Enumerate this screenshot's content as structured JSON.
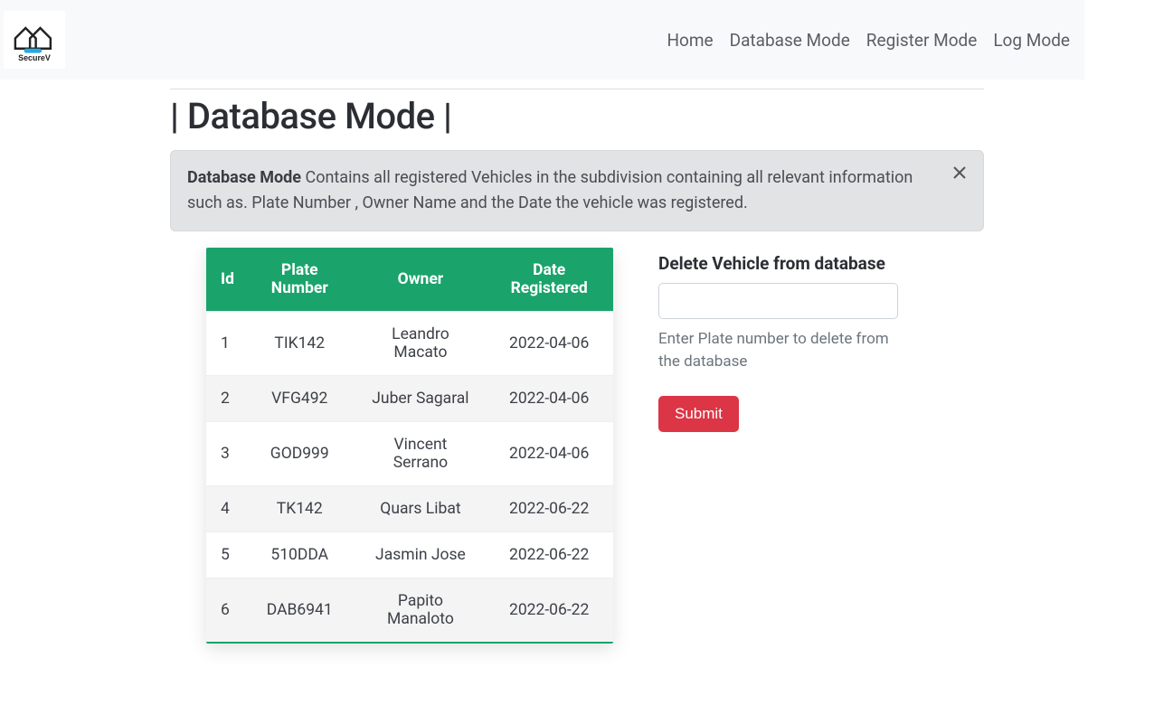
{
  "brand": "SecureV",
  "nav": {
    "home": "Home",
    "database": "Database Mode",
    "register": "Register Mode",
    "log": "Log Mode"
  },
  "title": "| Database Mode |",
  "alert": {
    "strong": "Database Mode",
    "body": " Contains all registered Vehicles in the subdivision containing all relevant information such as. Plate Number , Owner Name and the Date the vehicle was registered."
  },
  "table": {
    "headers": {
      "id": "Id",
      "plate": "Plate Number",
      "owner": "Owner",
      "date": "Date Registered"
    },
    "rows": [
      {
        "id": "1",
        "plate": "TIK142",
        "owner": "Leandro Macato",
        "date": "2022-04-06"
      },
      {
        "id": "2",
        "plate": "VFG492",
        "owner": "Juber Sagaral",
        "date": "2022-04-06"
      },
      {
        "id": "3",
        "plate": "GOD999",
        "owner": "Vincent Serrano",
        "date": "2022-04-06"
      },
      {
        "id": "4",
        "plate": "TK142",
        "owner": "Quars Libat",
        "date": "2022-06-22"
      },
      {
        "id": "5",
        "plate": "510DDA",
        "owner": "Jasmin Jose",
        "date": "2022-06-22"
      },
      {
        "id": "6",
        "plate": "DAB6941",
        "owner": "Papito Manaloto",
        "date": "2022-06-22"
      }
    ]
  },
  "delete_panel": {
    "title": "Delete Vehicle from database",
    "input_value": "",
    "helper": "Enter Plate number to delete from the database",
    "submit": "Submit"
  }
}
